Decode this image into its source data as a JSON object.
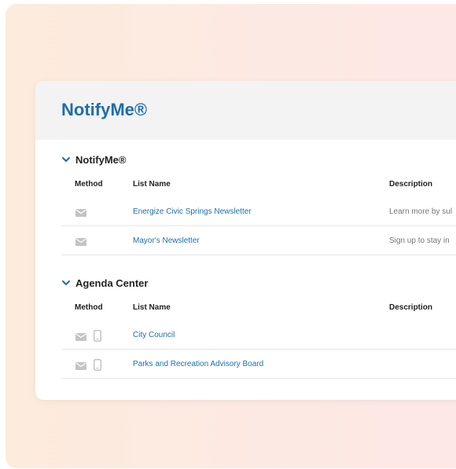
{
  "card": {
    "title": "NotifyMe®"
  },
  "sections": [
    {
      "title": "NotifyMe®",
      "headers": {
        "method": "Method",
        "list_name": "List Name",
        "description": "Description"
      },
      "rows": [
        {
          "list_name": "Energize Civic Springs Newsletter",
          "description": "Learn more by sul",
          "methods": [
            "mail-icon"
          ]
        },
        {
          "list_name": "Mayor's Newsletter",
          "description": "Sign up to stay in",
          "methods": [
            "mail-icon"
          ]
        }
      ]
    },
    {
      "title": "Agenda Center",
      "headers": {
        "method": "Method",
        "list_name": "List Name",
        "description": "Description"
      },
      "rows": [
        {
          "list_name": "City Council",
          "description": "",
          "methods": [
            "mail-icon",
            "phone-icon"
          ]
        },
        {
          "list_name": "Parks and Recreation Advisory Board",
          "description": "",
          "methods": [
            "mail-icon",
            "phone-icon"
          ]
        }
      ]
    }
  ],
  "colors": {
    "link": "#1f6ea8",
    "title": "#1f6ea8",
    "icon": "#c4c4c4"
  }
}
